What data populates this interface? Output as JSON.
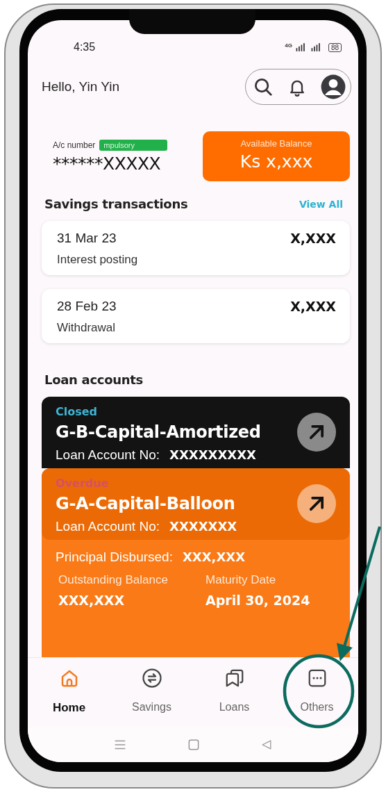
{
  "status_bar": {
    "time": "4:35",
    "network": "4G",
    "battery": "88"
  },
  "header": {
    "greeting": "Hello, Yin Yin"
  },
  "account": {
    "label": "A/c number",
    "tag": "mpulsory",
    "number": "******XXXXX"
  },
  "balance": {
    "label": "Available Balance",
    "amount": "Ks x,xxx"
  },
  "savings": {
    "title": "Savings transactions",
    "view_all": "View All",
    "transactions": [
      {
        "date": "31 Mar 23",
        "amount": "X,XXX",
        "description": "Interest posting"
      },
      {
        "date": "28 Feb 23",
        "amount": "X,XXX",
        "description": "Withdrawal"
      }
    ]
  },
  "loans": {
    "title": "Loan accounts",
    "accounts": [
      {
        "kind": "dark",
        "status": "Closed",
        "color": "#3fb4d4",
        "name": "G-B-Capital-Amortized",
        "account_label": "Loan Account No:",
        "account_no": "XXXXXXXXX"
      },
      {
        "kind": "orange",
        "status": "Overdue",
        "color": "#d4506a",
        "name": "G-A-Capital-Balloon",
        "account_label": "Loan Account No:",
        "account_no": "XXXXXXX",
        "principal_label": "Principal Disbursed:",
        "principal": "XXX,XXX",
        "outstanding_label": "Outstanding Balance",
        "outstanding": "XXX,XXX",
        "maturity_label": "Maturity Date",
        "maturity": "April 30, 2024"
      }
    ]
  },
  "tabs": [
    {
      "label": "Home",
      "kind": "home",
      "selected": true,
      "highlighted": false
    },
    {
      "label": "Savings",
      "kind": "exchange",
      "selected": false,
      "highlighted": false
    },
    {
      "label": "Loans",
      "kind": "cards",
      "selected": false,
      "highlighted": false
    },
    {
      "label": "Others",
      "kind": "more",
      "selected": false,
      "highlighted": true
    }
  ]
}
